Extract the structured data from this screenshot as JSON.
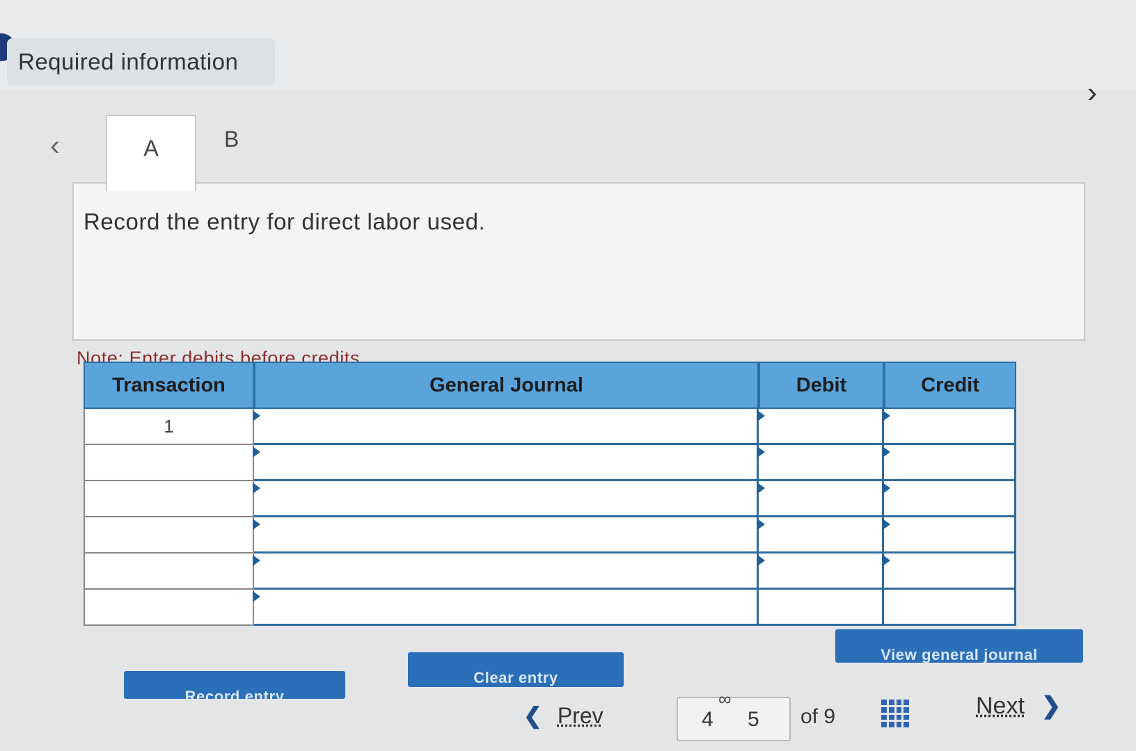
{
  "header": {
    "title": "Required information"
  },
  "tabs": [
    {
      "label": "A",
      "active": true
    },
    {
      "label": "B",
      "active": false
    }
  ],
  "question": {
    "prompt": "Record the entry for direct labor used."
  },
  "note": "Note: Enter debits before credits.",
  "journal": {
    "columns": {
      "transaction": "Transaction",
      "general_journal": "General Journal",
      "debit": "Debit",
      "credit": "Credit"
    },
    "rows": [
      {
        "transaction": "1",
        "account": "",
        "debit": "",
        "credit": ""
      },
      {
        "transaction": "",
        "account": "",
        "debit": "",
        "credit": ""
      },
      {
        "transaction": "",
        "account": "",
        "debit": "",
        "credit": ""
      },
      {
        "transaction": "",
        "account": "",
        "debit": "",
        "credit": ""
      },
      {
        "transaction": "",
        "account": "",
        "debit": "",
        "credit": ""
      },
      {
        "transaction": "",
        "account": "",
        "debit": "",
        "credit": ""
      }
    ]
  },
  "buttons": {
    "record_entry": "Record entry",
    "clear_entry": "Clear entry",
    "view_general_journal": "View general journal"
  },
  "pagination": {
    "prev": "Prev",
    "next": "Next",
    "pages": [
      "4",
      "5"
    ],
    "of_total": "of 9"
  },
  "icons": {
    "prev_tab": "chevron-left-icon",
    "next_question": "chevron-right-icon",
    "link": "link-icon",
    "grid": "grid-icon"
  },
  "colors": {
    "header_blue": "#5aa4dc",
    "button_blue": "#2a6fb8",
    "note_red": "#8a2f2a"
  }
}
